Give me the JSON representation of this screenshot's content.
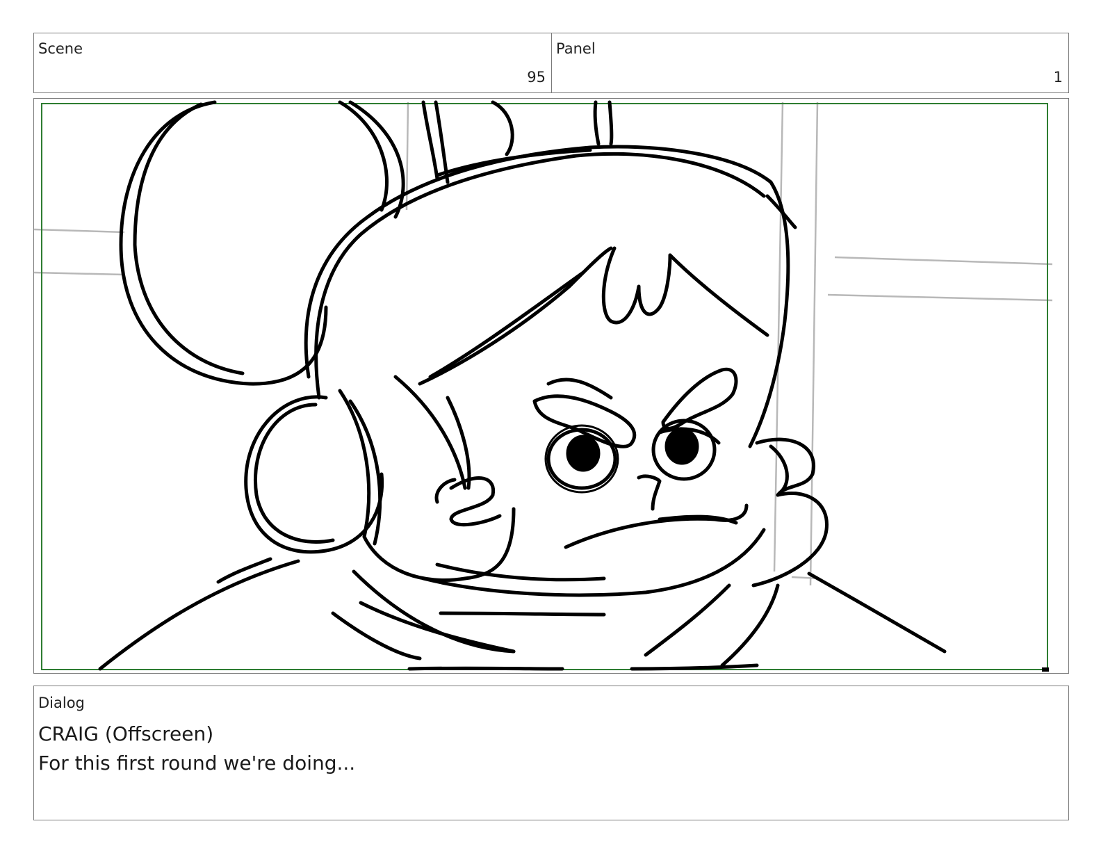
{
  "header": {
    "scene_label": "Scene",
    "scene_value": "95",
    "panel_label": "Panel",
    "panel_value": "1"
  },
  "image": {
    "subject": "storyboard-sketch-character-angry-face",
    "safe_area_color": "#2e7d32",
    "line_color": "#000000",
    "background_line_color": "#b8b8b8"
  },
  "dialog": {
    "label": "Dialog",
    "speaker": "CRAIG (Offscreen)",
    "text": "For this first round we're doing..."
  }
}
